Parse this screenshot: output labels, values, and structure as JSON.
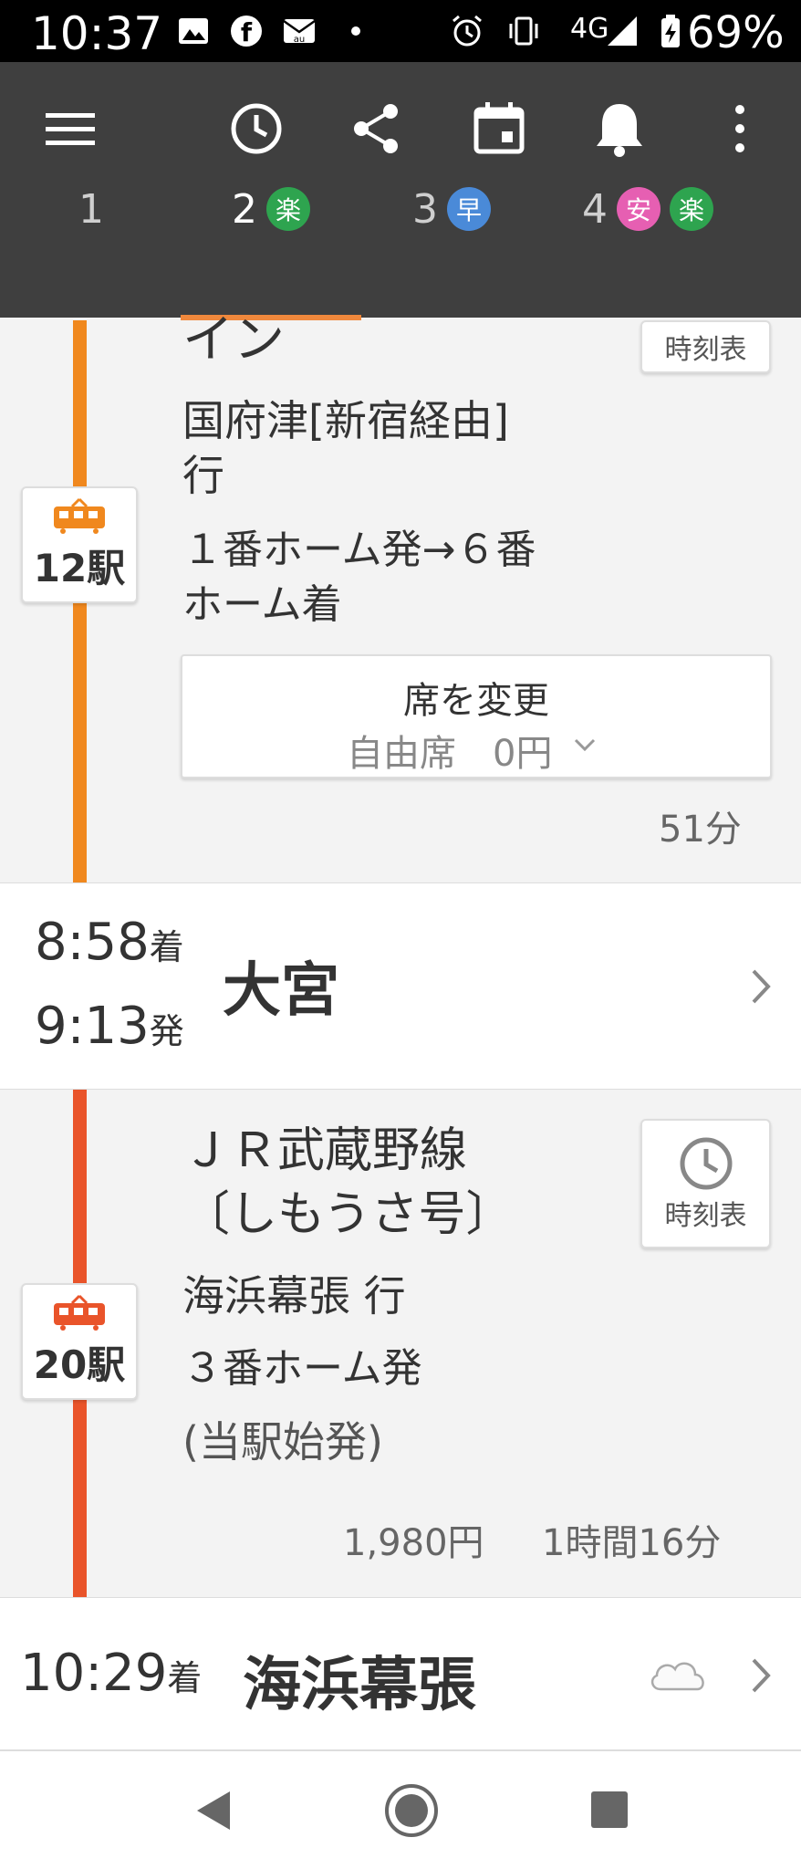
{
  "status_bar": {
    "time": "10:37",
    "network": "4G",
    "battery": "69%",
    "icons": [
      "image-icon",
      "facebook-icon",
      "au-mail-icon",
      "dot-icon",
      "alarm-icon",
      "vibrate-icon",
      "signal-icon",
      "battery-charging-icon"
    ]
  },
  "toolbar": {
    "icons": [
      "menu-icon",
      "history-icon",
      "share-icon",
      "calendar-icon",
      "bell-icon",
      "more-icon"
    ]
  },
  "tabs": [
    {
      "num": "1",
      "badges": []
    },
    {
      "num": "2",
      "badges": [
        {
          "text": "楽",
          "color": "#2ea44f"
        }
      ],
      "active": true
    },
    {
      "num": "3",
      "badges": [
        {
          "text": "早",
          "color": "#4a8ad8"
        }
      ]
    },
    {
      "num": "4",
      "badges": [
        {
          "text": "安",
          "color": "#e65fb2"
        },
        {
          "text": "楽",
          "color": "#2ea44f"
        }
      ]
    }
  ],
  "segment1": {
    "line_name_tail": "イン",
    "destination_line1": "国府津[新宿経由]",
    "destination_line2": "行",
    "platform_line1": "１番ホーム発→６番",
    "platform_line2": "ホーム着",
    "stations": "12駅",
    "timetable_label": "時刻表",
    "seat_title": "席を変更",
    "seat_sub": "自由席　0円",
    "duration": "51分",
    "line_color": "#f0881e"
  },
  "stop1": {
    "arrive_time": "8:58",
    "arrive_suffix": "着",
    "depart_time": "9:13",
    "depart_suffix": "発",
    "name": "大宮"
  },
  "segment2": {
    "line_name1": "ＪＲ武蔵野線",
    "line_name2": "〔しもうさ号〕",
    "destination": "海浜幕張 行",
    "platform": "３番ホーム発",
    "note": "(当駅始発)",
    "stations": "20駅",
    "timetable_label": "時刻表",
    "fare": "1,980円",
    "duration": "1時間16分",
    "line_color": "#e9542a"
  },
  "stop2": {
    "arrive_time": "10:29",
    "arrive_suffix": "着",
    "name": "海浜幕張",
    "weather_icon": "cloud-icon"
  },
  "navbar": {
    "icons": [
      "back-icon",
      "home-icon",
      "recents-icon"
    ]
  }
}
